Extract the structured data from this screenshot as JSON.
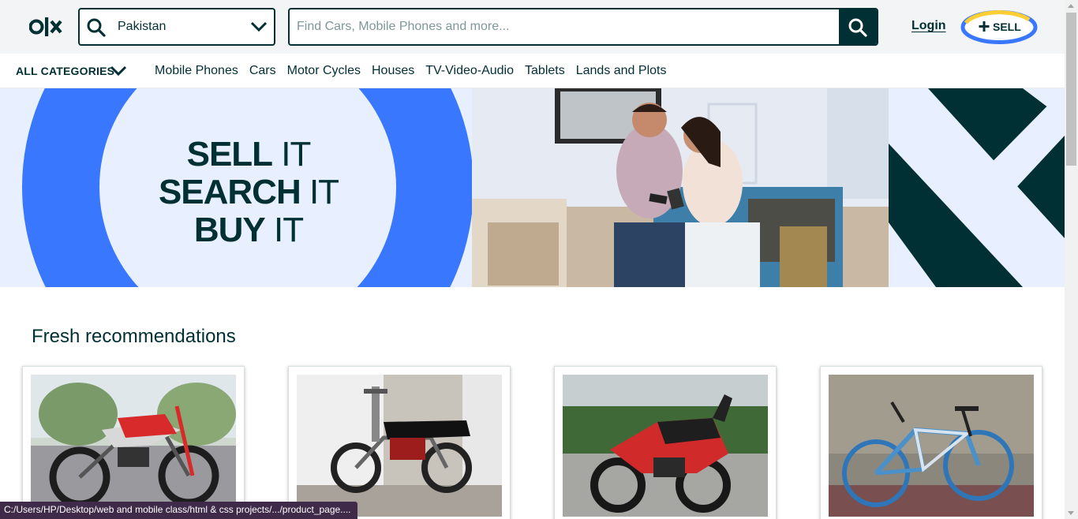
{
  "header": {
    "logo_text": "olx",
    "location": {
      "value": "Pakistan"
    },
    "search": {
      "placeholder": "Find Cars, Mobile Phones and more..."
    },
    "login_label": "Login",
    "sell_label": "SELL"
  },
  "categories": {
    "all_label": "ALL CATEGORIES",
    "items": [
      {
        "label": "Mobile Phones"
      },
      {
        "label": "Cars"
      },
      {
        "label": "Motor Cycles"
      },
      {
        "label": "Houses"
      },
      {
        "label": "TV-Video-Audio"
      },
      {
        "label": "Tablets"
      },
      {
        "label": "Lands and Plots"
      }
    ]
  },
  "hero": {
    "line1_bold": "SELL",
    "line1_rest": " IT",
    "line2_bold": "SEARCH",
    "line2_rest": " IT",
    "line3_bold": "BUY",
    "line3_rest": " IT"
  },
  "recommendations": {
    "title": "Fresh recommendations",
    "items": [
      {
        "image": "red-dirt-bike"
      },
      {
        "image": "red-motorcycle"
      },
      {
        "image": "red-sport-bike"
      },
      {
        "image": "blue-bicycle"
      }
    ]
  },
  "status_bar": {
    "text": "C:/Users/HP/Desktop/web and mobile class/html & css projects/.../product_page...."
  },
  "colors": {
    "brand_dark": "#002f34",
    "hero_blue": "#3a77ff",
    "hero_light": "#e8effe",
    "sell_yellow": "#ffce32",
    "sell_blue": "#3a77ff"
  }
}
